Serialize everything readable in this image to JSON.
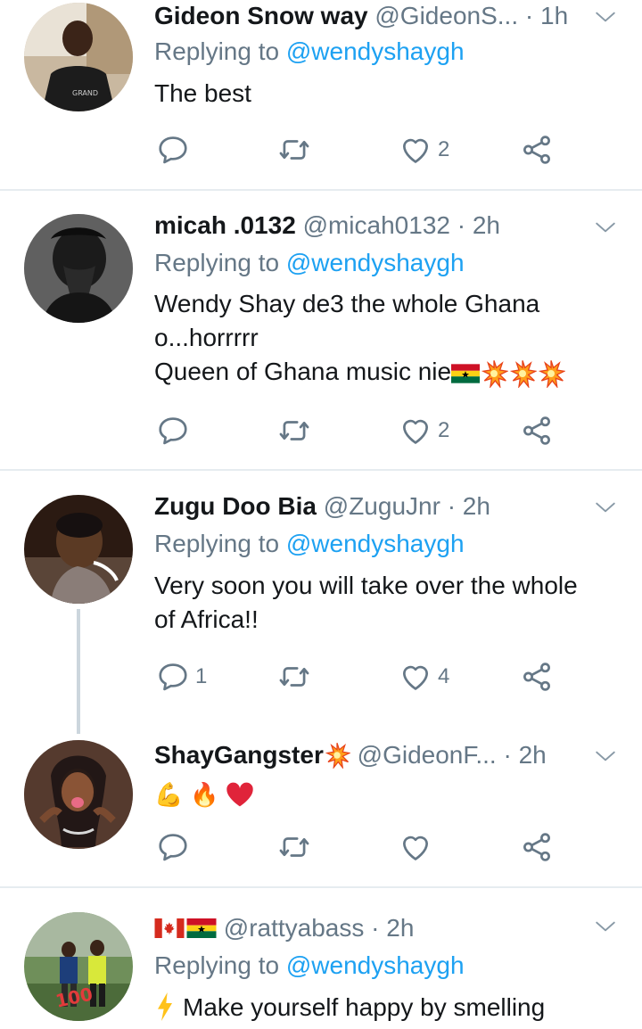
{
  "reply_prefix": "Replying to ",
  "tweets": [
    {
      "name": "Gideon Snow way",
      "handle": "@GideonS...",
      "time": "1h",
      "reply_to": "@wendyshaygh",
      "body_lines": [
        "The best"
      ],
      "counts": {
        "reply": "",
        "retweet": "",
        "like": "2"
      }
    },
    {
      "name": "micah .0132",
      "handle": "@micah0132",
      "time": "2h",
      "reply_to": "@wendyshaygh",
      "body_lines": [
        "Wendy Shay de3 the whole Ghana",
        "o...horrrrr",
        "Queen of Ghana music nie"
      ],
      "counts": {
        "reply": "",
        "retweet": "",
        "like": "2"
      }
    },
    {
      "name": "Zugu Doo Bia",
      "handle": "@ZuguJnr",
      "time": "2h",
      "reply_to": "@wendyshaygh",
      "body_lines": [
        "Very soon you will take over the whole",
        "of Africa!!"
      ],
      "counts": {
        "reply": "1",
        "retweet": "",
        "like": "4"
      }
    },
    {
      "name": "ShayGangster",
      "handle": "@GideonF...",
      "time": "2h",
      "reply_to": "",
      "body_lines": [],
      "counts": {
        "reply": "",
        "retweet": "",
        "like": ""
      }
    },
    {
      "name": "",
      "handle": "@rattyabass",
      "time": "2h",
      "reply_to": "@wendyshaygh",
      "body_lines": [
        "Make yourself happy by smelling"
      ],
      "counts": {
        "reply": "",
        "retweet": "",
        "like": ""
      }
    }
  ],
  "icons": [
    "reply-icon",
    "retweet-icon",
    "like-icon",
    "share-icon",
    "chevron-down-icon"
  ],
  "colors": {
    "link": "#1da1f2",
    "muted": "#657786",
    "text": "#14171a",
    "divider": "#e6ecf0"
  }
}
